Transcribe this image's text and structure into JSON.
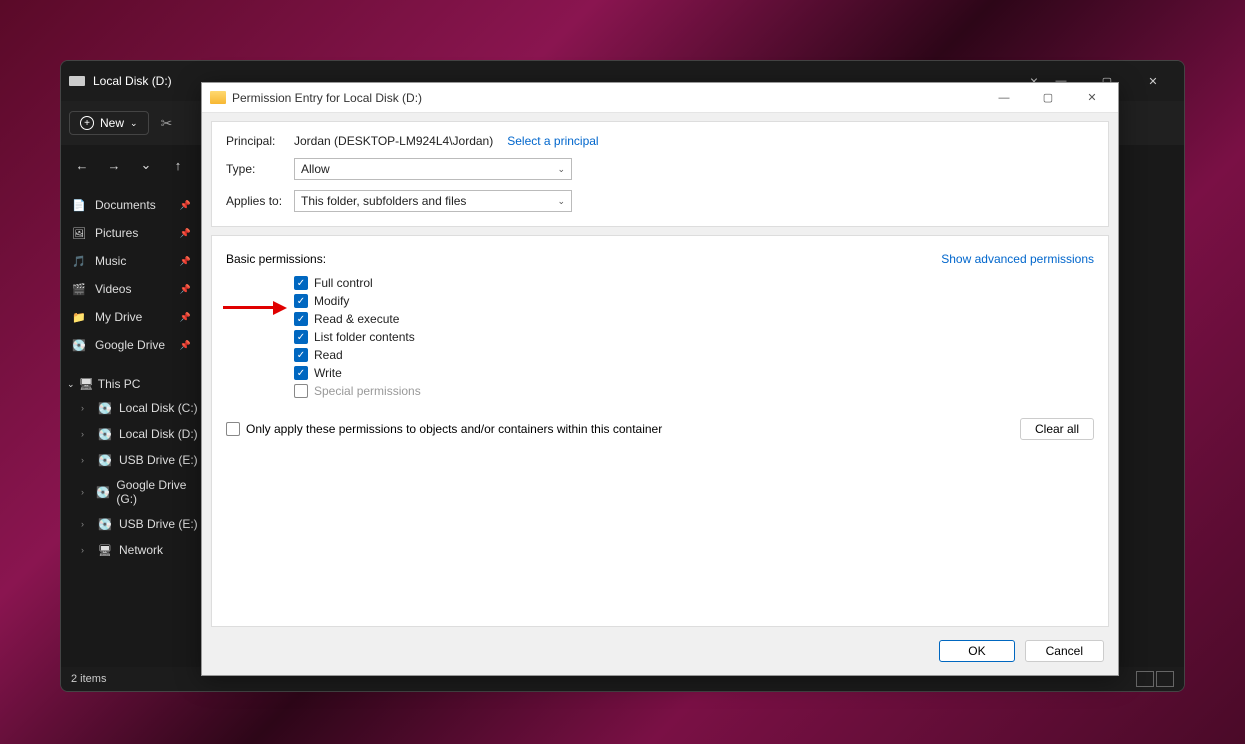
{
  "explorer": {
    "title": "Local Disk (D:)",
    "new_label": "New",
    "sidebar_quick": [
      {
        "icon": "📄",
        "label": "Documents",
        "pinned": true,
        "color": "#5aa3ff"
      },
      {
        "icon": "🖼",
        "label": "Pictures",
        "pinned": true,
        "color": "#5aa3ff"
      },
      {
        "icon": "🎵",
        "label": "Music",
        "pinned": true,
        "color": "#ff5a8a"
      },
      {
        "icon": "🎬",
        "label": "Videos",
        "pinned": true,
        "color": "#8a5aff"
      },
      {
        "icon": "📁",
        "label": "My Drive",
        "pinned": true,
        "color": "#ccc"
      },
      {
        "icon": "💽",
        "label": "Google Drive",
        "pinned": true,
        "color": "#ccc"
      }
    ],
    "sidebar_thispc_label": "This PC",
    "sidebar_thispc": [
      {
        "icon": "💽",
        "label": "Local Disk (C:)"
      },
      {
        "icon": "💽",
        "label": "Local Disk (D:)",
        "selected": true
      },
      {
        "icon": "💽",
        "label": "USB Drive (E:)"
      },
      {
        "icon": "💽",
        "label": "Google Drive (G:)"
      },
      {
        "icon": "💽",
        "label": "USB Drive (E:)"
      },
      {
        "icon": "🖥",
        "label": "Network"
      }
    ],
    "status": "2 items"
  },
  "dialog": {
    "title": "Permission Entry for Local Disk (D:)",
    "principal_label": "Principal:",
    "principal_value": "Jordan (DESKTOP-LM924L4\\Jordan)",
    "select_principal": "Select a principal",
    "type_label": "Type:",
    "type_value": "Allow",
    "applies_label": "Applies to:",
    "applies_value": "This folder, subfolders and files",
    "bp_label": "Basic permissions:",
    "show_advanced": "Show advanced permissions",
    "perms": [
      {
        "label": "Full control",
        "checked": true,
        "enabled": true
      },
      {
        "label": "Modify",
        "checked": true,
        "enabled": true
      },
      {
        "label": "Read & execute",
        "checked": true,
        "enabled": true
      },
      {
        "label": "List folder contents",
        "checked": true,
        "enabled": true
      },
      {
        "label": "Read",
        "checked": true,
        "enabled": true
      },
      {
        "label": "Write",
        "checked": true,
        "enabled": true
      },
      {
        "label": "Special permissions",
        "checked": false,
        "enabled": false
      }
    ],
    "only_apply_label": "Only apply these permissions to objects and/or containers within this container",
    "only_apply_checked": false,
    "clear_all": "Clear all",
    "ok": "OK",
    "cancel": "Cancel"
  }
}
